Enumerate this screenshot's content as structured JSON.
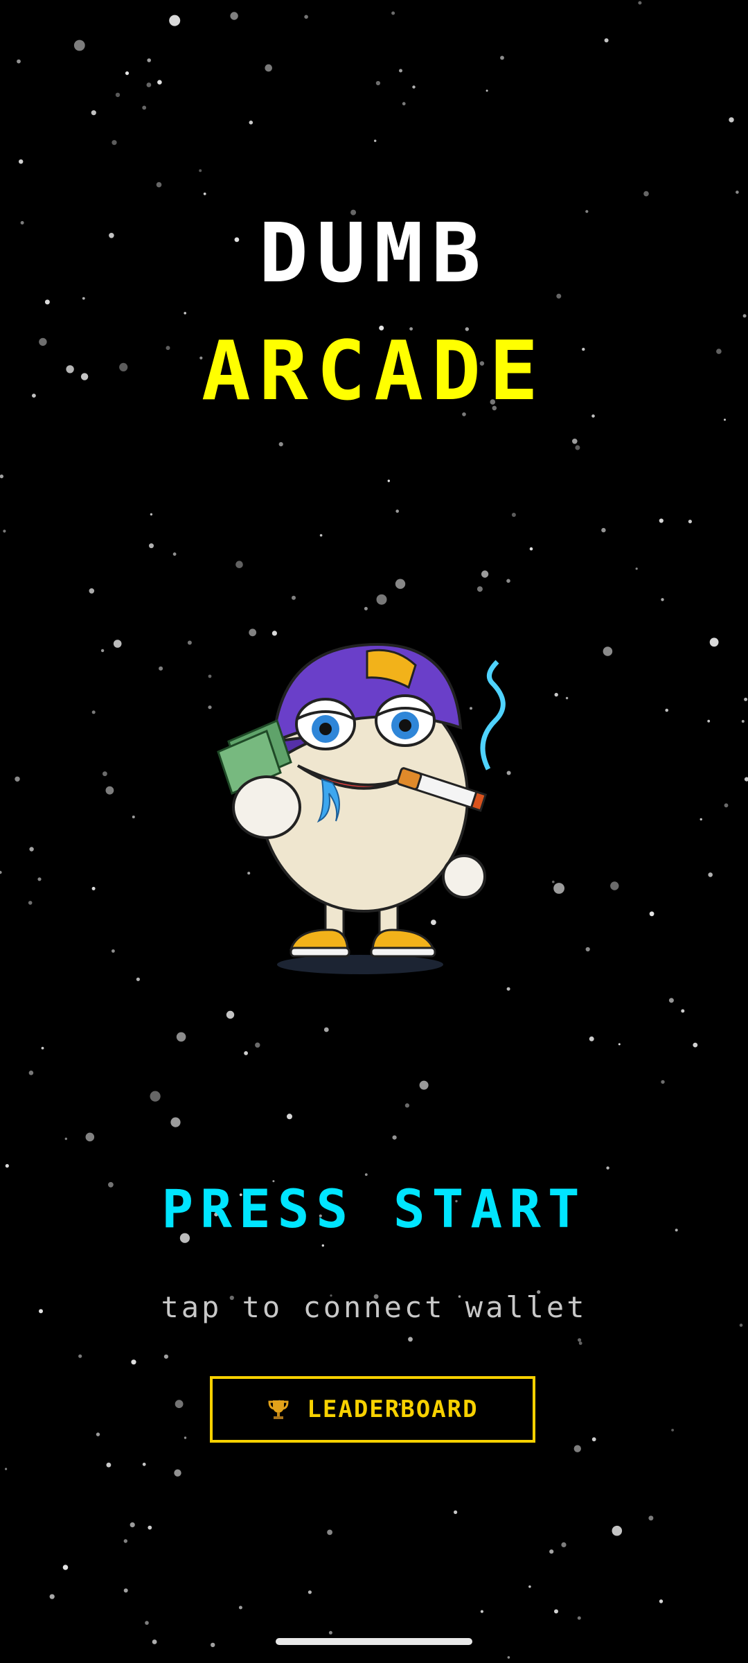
{
  "title": {
    "line1": "DUMB",
    "line2": "ARCADE"
  },
  "colors": {
    "background": "#000000",
    "title_primary": "#ffffff",
    "title_secondary": "#ffff00",
    "press_start": "#00e5ff",
    "accent_gold": "#f7d100",
    "subtext": "#c8c8c8"
  },
  "mascot": {
    "icon": "egg-mascot-icon"
  },
  "cta": {
    "press_start": "PRESS START",
    "subtitle": "tap to connect wallet"
  },
  "leaderboard": {
    "icon": "trophy-icon",
    "label": "LEADERBOARD"
  }
}
